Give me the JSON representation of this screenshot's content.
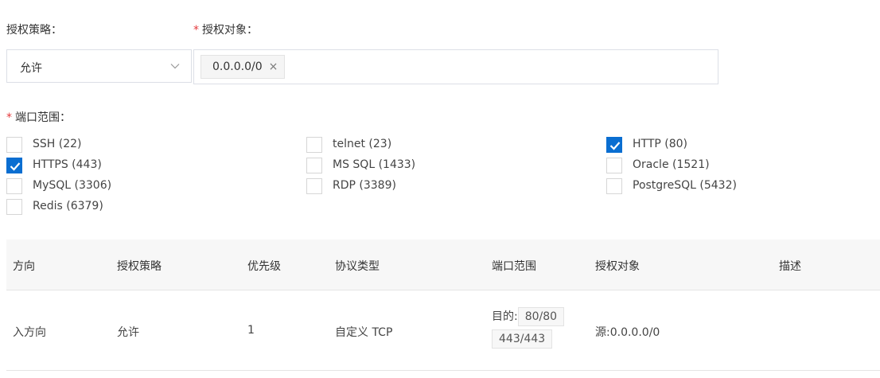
{
  "form": {
    "policy_label": "授权策略：",
    "target_label": "授权对象：",
    "ports_label": "端口范围：",
    "required_mark": "*",
    "policy_value": "允许",
    "target_tag": "0.0.0.0/0",
    "tag_remove": "×"
  },
  "ports": [
    {
      "label": "SSH (22)",
      "checked": false
    },
    {
      "label": "telnet (23)",
      "checked": false
    },
    {
      "label": "HTTP (80)",
      "checked": true
    },
    {
      "label": "HTTPS (443)",
      "checked": true
    },
    {
      "label": "MS SQL (1433)",
      "checked": false
    },
    {
      "label": "Oracle (1521)",
      "checked": false
    },
    {
      "label": "MySQL (3306)",
      "checked": false
    },
    {
      "label": "RDP (3389)",
      "checked": false
    },
    {
      "label": "PostgreSQL (5432)",
      "checked": false
    },
    {
      "label": "Redis (6379)",
      "checked": false
    }
  ],
  "table": {
    "headers": [
      "方向",
      "授权策略",
      "优先级",
      "协议类型",
      "端口范围",
      "授权对象",
      "描述"
    ],
    "row": {
      "direction": "入方向",
      "policy": "允许",
      "priority": "1",
      "protocol": "自定义 TCP",
      "port_prefix": "目的:",
      "port_ranges": [
        "80/80",
        "443/443"
      ],
      "target": "源:0.0.0.0/0",
      "description": ""
    }
  },
  "colors": {
    "accent": "#0a6ed1",
    "required": "#e4393c"
  }
}
